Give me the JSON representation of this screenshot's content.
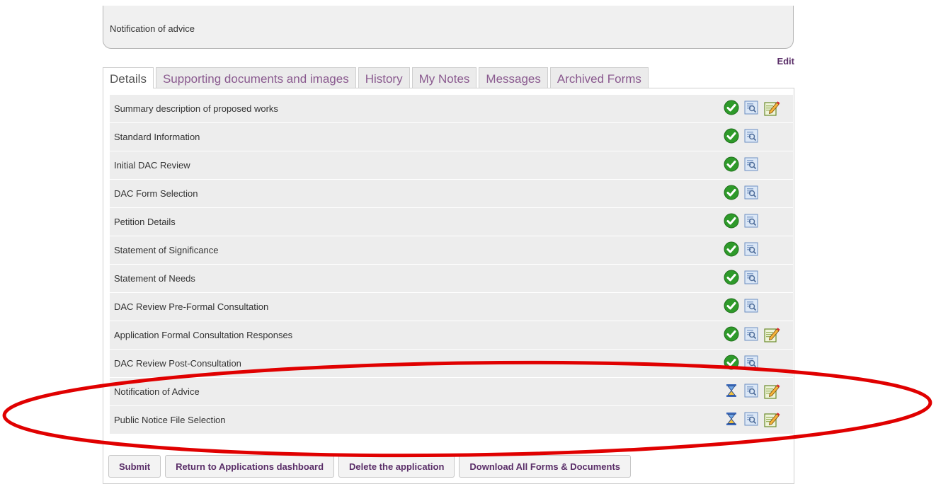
{
  "header": {
    "status_text": "Notification of advice",
    "edit_label": "Edit"
  },
  "tabs": [
    {
      "label": "Details",
      "active": true
    },
    {
      "label": "Supporting documents and images",
      "active": false
    },
    {
      "label": "History",
      "active": false
    },
    {
      "label": "My Notes",
      "active": false
    },
    {
      "label": "Messages",
      "active": false
    },
    {
      "label": "Archived Forms",
      "active": false
    }
  ],
  "forms": [
    {
      "label": "Summary description of proposed works",
      "status": "complete-check-icon",
      "editable": true
    },
    {
      "label": "Standard Information",
      "status": "complete-check-icon",
      "editable": false
    },
    {
      "label": "Initial DAC Review",
      "status": "complete-check-icon",
      "editable": false
    },
    {
      "label": "DAC Form Selection",
      "status": "complete-check-icon",
      "editable": false
    },
    {
      "label": "Petition Details",
      "status": "complete-check-icon",
      "editable": false
    },
    {
      "label": "Statement of Significance",
      "status": "complete-check-icon",
      "editable": false
    },
    {
      "label": "Statement of Needs",
      "status": "complete-check-icon",
      "editable": false
    },
    {
      "label": "DAC Review Pre-Formal Consultation",
      "status": "complete-check-icon",
      "editable": false
    },
    {
      "label": "Application Formal Consultation Responses",
      "status": "complete-check-icon",
      "editable": true
    },
    {
      "label": "DAC Review Post-Consultation",
      "status": "complete-check-icon",
      "editable": false
    },
    {
      "label": "Notification of Advice",
      "status": "pending-hourglass-icon",
      "editable": true
    },
    {
      "label": "Public Notice File Selection",
      "status": "pending-hourglass-icon",
      "editable": true
    }
  ],
  "actions": {
    "submit": "Submit",
    "return_dashboard": "Return to Applications dashboard",
    "delete": "Delete the application",
    "download_all": "Download All Forms & Documents"
  },
  "colors": {
    "accent_text": "#5a2e68",
    "tab_text": "#8a5a8f",
    "complete_green": "#2e9a2a",
    "annotation_red": "#e00000"
  }
}
